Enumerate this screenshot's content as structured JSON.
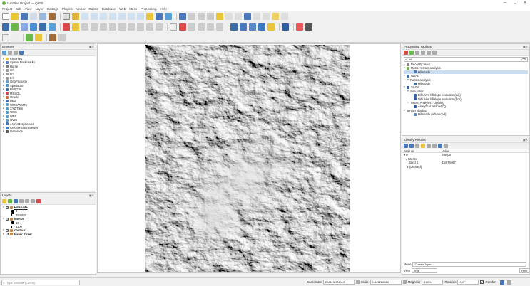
{
  "window": {
    "title": "*Untitled Project — QGIS",
    "minimize": "—",
    "maximize": "❐",
    "close": "✕"
  },
  "menu": [
    "Project",
    "Edit",
    "View",
    "Layer",
    "Settings",
    "Plugins",
    "Vector",
    "Raster",
    "Database",
    "Web",
    "Mesh",
    "Processing",
    "Help"
  ],
  "browser": {
    "title": "Browser",
    "items": [
      {
        "label": "Favorites",
        "icon": "star-icon",
        "color": "#e8c53a",
        "indent": 1
      },
      {
        "label": "Spatial Bookmarks",
        "icon": "bookmark-icon",
        "color": "#5b7fc4",
        "indent": 1
      },
      {
        "label": "Home",
        "icon": "home-icon",
        "color": "#7a7a7a",
        "indent": 1
      },
      {
        "label": "C:\\",
        "icon": "drive-icon",
        "color": "#999",
        "indent": 1
      },
      {
        "label": "D:\\",
        "icon": "drive-icon",
        "color": "#999",
        "indent": 1
      },
      {
        "label": "E:\\",
        "icon": "drive-icon",
        "color": "#999",
        "indent": 1
      },
      {
        "label": "GeoPackage",
        "icon": "geopackage-icon",
        "color": "#6a9bd1",
        "indent": 1
      },
      {
        "label": "SpatiaLite",
        "icon": "spatialite-icon",
        "color": "#4a8fd0",
        "indent": 1
      },
      {
        "label": "PostGIS",
        "icon": "postgis-icon",
        "color": "#3c6fa8",
        "indent": 1
      },
      {
        "label": "MSSQL",
        "icon": "mssql-icon",
        "color": "#c94a4a",
        "indent": 1
      },
      {
        "label": "Oracle",
        "icon": "oracle-icon",
        "color": "#d86b2b",
        "indent": 1
      },
      {
        "label": "DB2",
        "icon": "db2-icon",
        "color": "#4b6fb5",
        "indent": 1
      },
      {
        "label": "WMS/WMTS",
        "icon": "wms-icon",
        "color": "#5a9fd4",
        "indent": 1
      },
      {
        "label": "XYZ Tiles",
        "icon": "xyz-icon",
        "color": "#5a9fd4",
        "indent": 1
      },
      {
        "label": "WCS",
        "icon": "wcs-icon",
        "color": "#5a9fd4",
        "indent": 1
      },
      {
        "label": "WFS",
        "icon": "wfs-icon",
        "color": "#5a9fd4",
        "indent": 1
      },
      {
        "label": "OWS",
        "icon": "ows-icon",
        "color": "#5a9fd4",
        "indent": 1
      },
      {
        "label": "ArcGisMapServer",
        "icon": "arcgis-icon",
        "color": "#3a7bbf",
        "indent": 1
      },
      {
        "label": "ArcGisFeatureServer",
        "icon": "arcgis-icon",
        "color": "#3a7bbf",
        "indent": 1
      },
      {
        "label": "GeoNode",
        "icon": "geonode-icon",
        "color": "#555",
        "indent": 1
      }
    ]
  },
  "layers": {
    "title": "Layers",
    "items": [
      {
        "label": "Hillshade",
        "bold": true,
        "checked": true,
        "underline": true
      },
      {
        "label": "254.882",
        "legend": true,
        "swatch": "#fff"
      },
      {
        "label": "Interpo",
        "bold": true,
        "checked": true
      },
      {
        "label": "10",
        "legend": true,
        "swatch": "#000"
      },
      {
        "label": "1100",
        "legend": true,
        "swatch": "#fff"
      },
      {
        "label": "contour",
        "bold": true,
        "checked": true
      },
      {
        "label": "Naver Street",
        "bold": true,
        "checked": true
      }
    ],
    "hillshade_legend_top": "0"
  },
  "processing": {
    "title": "Processing Toolbox",
    "search": "hill",
    "tree": [
      {
        "label": "Recently used",
        "indent": 0,
        "arrow": "▸",
        "icon": "clock-icon",
        "color": "#888"
      },
      {
        "label": "Raster terrain analysis",
        "indent": 0,
        "arrow": "▾",
        "icon": "qgis-icon",
        "color": "#6bb84a"
      },
      {
        "label": "Hillshade",
        "indent": 2,
        "arrow": "",
        "icon": "algorithm-icon",
        "color": "#4a78b8",
        "selected": true
      },
      {
        "label": "GDAL",
        "indent": 0,
        "arrow": "▾",
        "icon": "gdal-icon",
        "color": "#3c6fa8"
      },
      {
        "label": "Raster analysis",
        "indent": 1,
        "arrow": "▾",
        "icon": "",
        "color": ""
      },
      {
        "label": "Hillshade",
        "indent": 2,
        "arrow": "",
        "icon": "algorithm-icon",
        "color": "#3c6fa8"
      },
      {
        "label": "SAGA",
        "indent": 0,
        "arrow": "▾",
        "icon": "saga-icon",
        "color": "#2f5f9e"
      },
      {
        "label": "Simulation",
        "indent": 1,
        "arrow": "▾",
        "icon": "",
        "color": ""
      },
      {
        "label": "Diffusive hillslope evolution (adi)",
        "indent": 2,
        "arrow": "",
        "icon": "algorithm-icon",
        "color": "#2f5f9e"
      },
      {
        "label": "Diffusive hillslope evolution (ftcs)",
        "indent": 2,
        "arrow": "",
        "icon": "algorithm-icon",
        "color": "#2f5f9e"
      },
      {
        "label": "Terrain Analysis - Lighting",
        "indent": 1,
        "arrow": "▾",
        "icon": "",
        "color": ""
      },
      {
        "label": "Analytical hillshading",
        "indent": 2,
        "arrow": "",
        "icon": "algorithm-icon",
        "color": "#2f5f9e"
      },
      {
        "label": "Terrain shading",
        "indent": 0,
        "arrow": "▾",
        "icon": "",
        "color": ""
      },
      {
        "label": "Hillshade (advanced)",
        "indent": 2,
        "arrow": "",
        "icon": "algorithm-icon",
        "color": "#5a8ac4"
      }
    ]
  },
  "identify": {
    "title": "Identify Results",
    "col_feature": "Feature",
    "col_value": "Value",
    "rows": [
      {
        "feature": "▾ 0",
        "value": "Interpo"
      },
      {
        "feature": "  ▾ Interpo",
        "value": ""
      },
      {
        "feature": "      Band 1",
        "value": "434.74467"
      },
      {
        "feature": "    ▸ (Derived)",
        "value": ""
      }
    ],
    "mode_label": "Mode",
    "mode_value": "Current layer",
    "view_label": "View",
    "view_value": "Tree",
    "help": "Help"
  },
  "status": {
    "locate_placeholder": "Type to locate (Ctrl+K)",
    "coord_label": "Coordinate",
    "coord_value": "236119,306119",
    "scale_label": "Scale",
    "scale_value": "1:467208980",
    "magnifier_label": "Magnifier",
    "magnifier_value": "100%",
    "rotation_label": "Rotation",
    "rotation_value": "0.0 °",
    "render_label": "Render"
  }
}
